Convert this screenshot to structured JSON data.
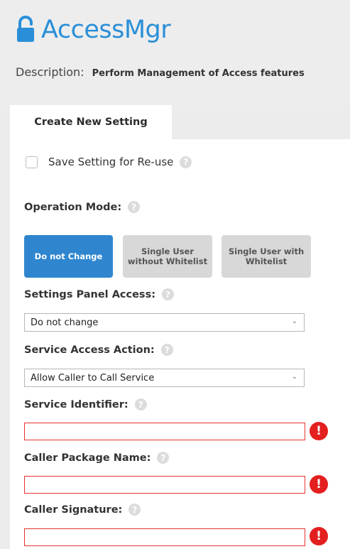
{
  "app": {
    "title": "AccessMgr",
    "accent_color": "#2a8fd8",
    "icon": "unlock-icon"
  },
  "description": {
    "label": "Description:",
    "value": "Perform Management of Access features"
  },
  "tabs": [
    {
      "label": "Create New Setting",
      "active": true
    }
  ],
  "save_setting": {
    "label": "Save Setting for Re-use",
    "checked": false,
    "help_icon": "?"
  },
  "operation_mode": {
    "label": "Operation Mode:",
    "help_icon": "?",
    "options": [
      {
        "label": "Do not Change",
        "selected": true
      },
      {
        "label": "Single User without Whitelist",
        "selected": false
      },
      {
        "label": "Single User with Whitelist",
        "selected": false
      }
    ]
  },
  "settings_panel_access": {
    "label": "Settings Panel Access:",
    "help_icon": "?",
    "value": "Do not change"
  },
  "service_access_action": {
    "label": "Service Access Action:",
    "help_icon": "?",
    "value": "Allow Caller to Call Service"
  },
  "service_identifier": {
    "label": "Service Identifier:",
    "help_icon": "?",
    "value": "",
    "error_icon": "!"
  },
  "caller_package_name": {
    "label": "Caller Package Name:",
    "help_icon": "?",
    "value": "",
    "error_icon": "!"
  },
  "caller_signature": {
    "label": "Caller Signature:",
    "help_icon": "?",
    "value": "",
    "error_icon": "!"
  },
  "colors": {
    "primary_button": "#2f86cf",
    "inactive_button": "#d8d8d8",
    "error": "#e41f1f"
  }
}
